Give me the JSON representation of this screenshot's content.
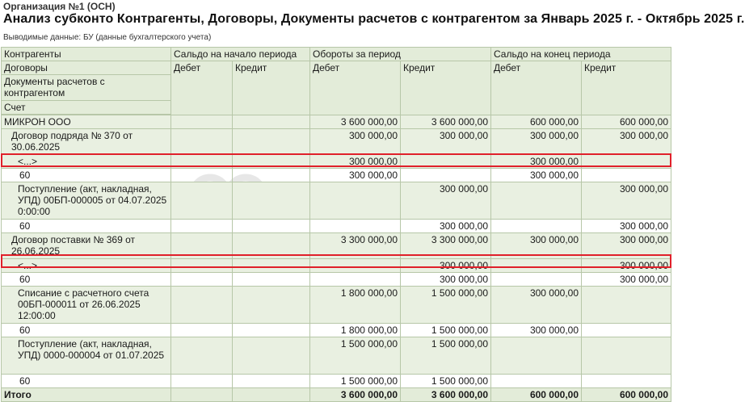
{
  "organization": "Организация №1 (ОСН)",
  "title": "Анализ субконто Контрагенты, Договоры, Документы расчетов с контрагентом за Январь 2025 г. - Октябрь 2025 г.",
  "subtitle": "Выводимые данные: БУ (данные бухгалтерского учета)",
  "watermark": "БУХЭКСПЕРТ",
  "header": {
    "dim1": "Контрагенты",
    "dim2": "Договоры",
    "dim3": "Документы расчетов с контрагентом",
    "dim4": "Счет",
    "opening": "Сальдо на начало периода",
    "turnover": "Обороты за период",
    "closing": "Сальдо на конец периода",
    "debit": "Дебет",
    "credit": "Кредит"
  },
  "rows": [
    {
      "name": "МИКРОН ООО",
      "od": "",
      "oc": "",
      "td": "3 600 000,00",
      "tc": "3 600 000,00",
      "cd": "600 000,00",
      "cc": "600 000,00"
    },
    {
      "name": "Договор подряда № 370 от 30.06.2025",
      "od": "",
      "oc": "",
      "td": "300 000,00",
      "tc": "300 000,00",
      "cd": "300 000,00",
      "cc": "300 000,00"
    },
    {
      "name": "<...>",
      "od": "",
      "oc": "",
      "td": "300 000,00",
      "tc": "",
      "cd": "300 000,00",
      "cc": ""
    },
    {
      "name": "60",
      "od": "",
      "oc": "",
      "td": "300 000,00",
      "tc": "",
      "cd": "300 000,00",
      "cc": ""
    },
    {
      "name": "Поступление (акт, накладная, УПД) 00БП-000005 от 04.07.2025 0:00:00",
      "od": "",
      "oc": "",
      "td": "",
      "tc": "300 000,00",
      "cd": "",
      "cc": "300 000,00"
    },
    {
      "name": "60",
      "od": "",
      "oc": "",
      "td": "",
      "tc": "300 000,00",
      "cd": "",
      "cc": "300 000,00"
    },
    {
      "name": "Договор поставки № 369 от 26.06.2025",
      "od": "",
      "oc": "",
      "td": "3 300 000,00",
      "tc": "3 300 000,00",
      "cd": "300 000,00",
      "cc": "300 000,00"
    },
    {
      "name": "<...>",
      "od": "",
      "oc": "",
      "td": "",
      "tc": "300 000,00",
      "cd": "",
      "cc": "300 000,00"
    },
    {
      "name": "60",
      "od": "",
      "oc": "",
      "td": "",
      "tc": "300 000,00",
      "cd": "",
      "cc": "300 000,00"
    },
    {
      "name": "Списание с расчетного счета 00БП-000011 от 26.06.2025 12:00:00",
      "od": "",
      "oc": "",
      "td": "1 800 000,00",
      "tc": "1 500 000,00",
      "cd": "300 000,00",
      "cc": ""
    },
    {
      "name": "60",
      "od": "",
      "oc": "",
      "td": "1 800 000,00",
      "tc": "1 500 000,00",
      "cd": "300 000,00",
      "cc": ""
    },
    {
      "name": "Поступление (акт, накладная, УПД) 0000-000004 от 01.07.2025",
      "od": "",
      "oc": "",
      "td": "1 500 000,00",
      "tc": "1 500 000,00",
      "cd": "",
      "cc": ""
    },
    {
      "name": "60",
      "od": "",
      "oc": "",
      "td": "1 500 000,00",
      "tc": "1 500 000,00",
      "cd": "",
      "cc": ""
    }
  ],
  "total": {
    "name": "Итого",
    "od": "",
    "oc": "",
    "td": "3 600 000,00",
    "tc": "3 600 000,00",
    "cd": "600 000,00",
    "cc": "600 000,00"
  }
}
